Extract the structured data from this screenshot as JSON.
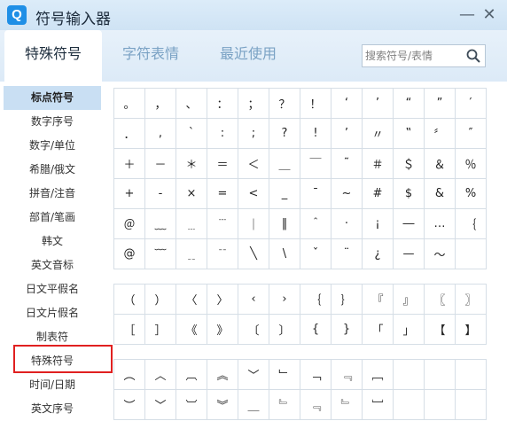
{
  "window": {
    "app_icon_letter": "Q",
    "title": "符号输入器"
  },
  "controls": {
    "minimize": "—",
    "close": "✕"
  },
  "tabs": [
    {
      "label": "特殊符号",
      "active": true
    },
    {
      "label": "字符表情",
      "active": false
    },
    {
      "label": "最近使用",
      "active": false
    }
  ],
  "search": {
    "placeholder": "搜索符号/表情",
    "icon": "search-icon"
  },
  "sidebar": {
    "items": [
      {
        "label": "标点符号",
        "active": true
      },
      {
        "label": "数字序号",
        "active": false
      },
      {
        "label": "数字/单位",
        "active": false
      },
      {
        "label": "希腊/俄文",
        "active": false
      },
      {
        "label": "拼音/注音",
        "active": false
      },
      {
        "label": "部首/笔画",
        "active": false
      },
      {
        "label": "韩文",
        "active": false
      },
      {
        "label": "英文音标",
        "active": false
      },
      {
        "label": "日文平假名",
        "active": false
      },
      {
        "label": "日文片假名",
        "active": false
      },
      {
        "label": "制表符",
        "active": false
      },
      {
        "label": "特殊符号",
        "active": false
      },
      {
        "label": "时间/日期",
        "active": false
      },
      {
        "label": "英文序号",
        "active": false
      }
    ]
  },
  "symbol_groups": [
    {
      "rows": [
        [
          "。",
          "，",
          "、",
          "：",
          "；",
          "？",
          "！",
          "‘",
          "’",
          "“",
          "”",
          "′"
        ],
        [
          "．",
          ",",
          "ˋ",
          ":",
          ";",
          "?",
          "!",
          "’",
          "〃",
          "‟",
          "〞",
          "″"
        ],
        [
          "＋",
          "－",
          "＊",
          "＝",
          "＜",
          "＿",
          "￣",
          "˜",
          "＃",
          "＄",
          "＆",
          "％"
        ],
        [
          "+",
          "-",
          "×",
          "=",
          "<",
          "_",
          "¯",
          "~",
          "#",
          "$",
          "&",
          "%"
        ],
        [
          "＠",
          "﹏",
          "﹍",
          "﹉",
          "｜",
          "‖",
          "＾",
          "·",
          "¡",
          "―",
          "…",
          "｛"
        ],
        [
          "@",
          "﹋",
          "﹎",
          "﹊",
          "╲",
          "\\",
          "ˇ",
          "¨",
          "¿",
          "—",
          "～",
          ""
        ]
      ]
    },
    {
      "rows": [
        [
          "（",
          "）",
          "〈",
          "〉",
          "‹",
          "›",
          "｛",
          "｝",
          "『",
          "』",
          "〖",
          "〗"
        ],
        [
          "［",
          "］",
          "《",
          "》",
          "〔",
          "〕",
          "{",
          "}",
          "「",
          "」",
          "【",
          "】"
        ]
      ]
    },
    {
      "rows": [
        [
          "︵",
          "︿",
          "︹",
          "︽",
          "﹀",
          "﹂",
          "﹁",
          "﹃",
          "﹇",
          "",
          "",
          ""
        ],
        [
          "︶",
          "﹀",
          "︺",
          "︾",
          "＿",
          "﹄",
          "﹃",
          "﹄",
          "﹈",
          "",
          "",
          ""
        ]
      ]
    }
  ]
}
